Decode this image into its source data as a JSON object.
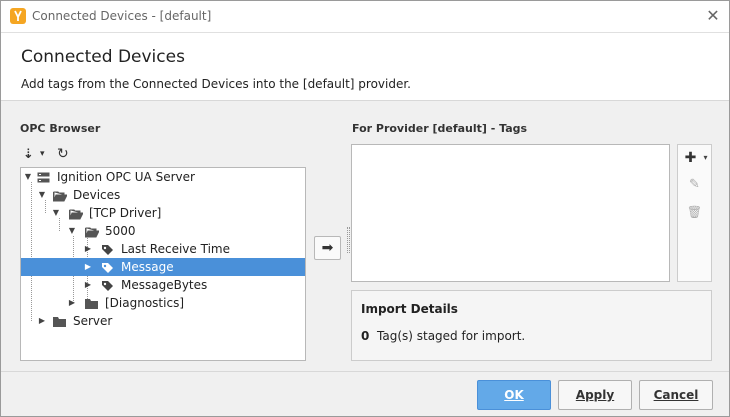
{
  "window": {
    "title": "Connected Devices - [default]",
    "close_glyph": "✕",
    "app_icon": "ignition-icon"
  },
  "header": {
    "title": "Connected Devices",
    "subtitle": "Add tags from the Connected Devices into the [default] provider."
  },
  "opc_browser": {
    "label": "OPC Browser",
    "sort_glyph": "⇣",
    "sort_caret": "▾",
    "refresh_glyph": "↻",
    "tree": [
      {
        "label": "Ignition OPC UA Server",
        "icon": "server-icon",
        "expanded": true,
        "depth": 0
      },
      {
        "label": "Devices",
        "icon": "folder-open-icon",
        "expanded": true,
        "depth": 1
      },
      {
        "label": "[TCP Driver]",
        "icon": "folder-open-icon",
        "expanded": true,
        "depth": 2
      },
      {
        "label": "5000",
        "icon": "folder-open-icon",
        "expanded": true,
        "depth": 3
      },
      {
        "label": "Last Receive Time",
        "icon": "tag-icon",
        "expanded": false,
        "depth": 4
      },
      {
        "label": "Message",
        "icon": "tag-icon",
        "expanded": false,
        "depth": 4,
        "selected": true
      },
      {
        "label": "MessageBytes",
        "icon": "tag-icon",
        "expanded": false,
        "depth": 4
      },
      {
        "label": "[Diagnostics]",
        "icon": "folder-icon",
        "expanded": false,
        "depth": 3
      },
      {
        "label": "Server",
        "icon": "folder-icon",
        "expanded": false,
        "depth": 1
      }
    ]
  },
  "transfer_button": {
    "glyph": "➡"
  },
  "provider_tags": {
    "label": "For Provider [default] - Tags",
    "add_glyph": "✚",
    "add_caret": "▾",
    "edit_glyph": "✎",
    "delete_glyph": "🗑"
  },
  "import_details": {
    "title": "Import Details",
    "count": "0",
    "text": "Tag(s) staged for import."
  },
  "footer": {
    "ok_label": "OK",
    "apply_label": "Apply",
    "cancel_label": "Cancel"
  },
  "colors": {
    "selection": "#4a90d9",
    "primary_button": "#63a9e8",
    "app_icon": "#f5a623"
  }
}
